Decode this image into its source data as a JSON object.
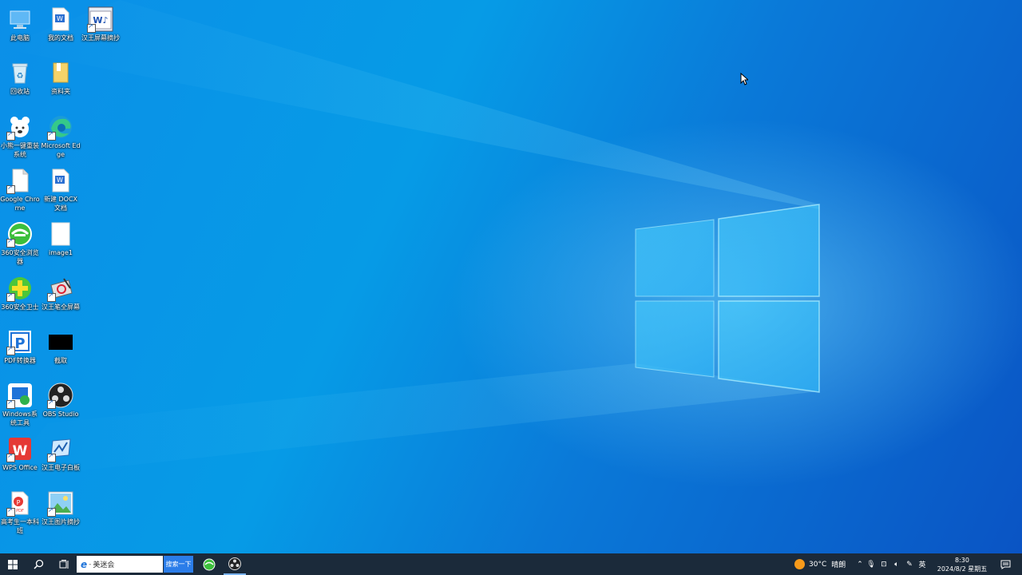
{
  "desktop": {
    "icons": [
      {
        "label": "此电脑",
        "icon": "this-pc-icon"
      },
      {
        "label": "我的文档",
        "icon": "word-document-icon"
      },
      {
        "label": "汉王屏幕摘抄",
        "icon": "hanwang-screen-icon"
      },
      {
        "label": "回收站",
        "icon": "recycle-bin-icon"
      },
      {
        "label": "资料夹",
        "icon": "folder-icon"
      },
      {
        "label": "小熊一键重装系统",
        "icon": "bear-icon"
      },
      {
        "label": "Microsoft Edge",
        "icon": "edge-icon"
      },
      {
        "label": "Google Chrome",
        "icon": "file-icon"
      },
      {
        "label": "新建 DOCX 文档",
        "icon": "word-document-icon"
      },
      {
        "label": "360安全浏览器",
        "icon": "browser-360-icon"
      },
      {
        "label": "image1",
        "icon": "blank-file-icon"
      },
      {
        "label": "360安全卫士",
        "icon": "guard-360-icon"
      },
      {
        "label": "汉王笔全屏幕",
        "icon": "pen-tablet-icon"
      },
      {
        "label": "PDF转换器",
        "icon": "pdf-converter-icon"
      },
      {
        "label": "截取",
        "icon": "black-image-icon"
      },
      {
        "label": "Windows系统工具",
        "icon": "windows-tools-icon"
      },
      {
        "label": "OBS Studio",
        "icon": "obs-icon"
      },
      {
        "label": "WPS Office",
        "icon": "wps-icon"
      },
      {
        "label": "汉王电子白板",
        "icon": "whiteboard-icon"
      },
      {
        "label": "高考生一本科班",
        "icon": "pdf-icon"
      },
      {
        "label": "汉王图片摘抄",
        "icon": "picture-icon"
      }
    ]
  },
  "taskbar": {
    "search": {
      "value": "美迷会",
      "button_label": "搜索一下"
    },
    "weather": {
      "temp": "30°C",
      "condition": "晴朗"
    },
    "ime": "英",
    "clock": {
      "time": "8:30",
      "date": "2024/8/2 星期五"
    }
  },
  "colors": {
    "taskbar": "#1b2a3a",
    "accent": "#2b7de9"
  }
}
